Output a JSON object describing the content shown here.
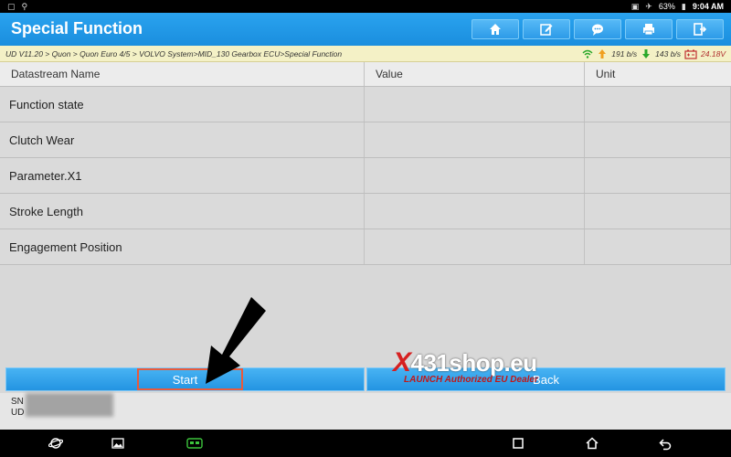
{
  "status_bar": {
    "battery": "63%",
    "time": "9:04 AM"
  },
  "header": {
    "title": "Special Function",
    "toolbar": [
      "home-icon",
      "edit-icon",
      "chat-icon",
      "print-icon",
      "exit-icon"
    ]
  },
  "breadcrumb": {
    "path": "UD V11.20 > Quon > Quon Euro 4/5 > VOLVO System>MID_130 Gearbox ECU>Special Function",
    "up_rate": "191 b/s",
    "down_rate": "143 b/s",
    "voltage": "24.18V"
  },
  "table": {
    "headers": [
      "Datastream Name",
      "Value",
      "Unit"
    ],
    "rows": [
      {
        "name": "Function state",
        "value": "",
        "unit": ""
      },
      {
        "name": "Clutch Wear",
        "value": "",
        "unit": ""
      },
      {
        "name": "Parameter.X1",
        "value": "",
        "unit": ""
      },
      {
        "name": "Stroke Length",
        "value": "",
        "unit": ""
      },
      {
        "name": "Engagement Position",
        "value": "",
        "unit": ""
      }
    ]
  },
  "actions": {
    "start": "Start",
    "back": "Back"
  },
  "footer": {
    "sn_label": "SN",
    "ud_label": "UD"
  },
  "watermark": {
    "x": "X",
    "brand": "431shop.eu",
    "tagline": "LAUNCH Authorized EU Dealer"
  },
  "colors": {
    "header_blue": "#1a8ede",
    "highlight": "#e85a3c",
    "crumb_bg": "#f4f1c6"
  }
}
